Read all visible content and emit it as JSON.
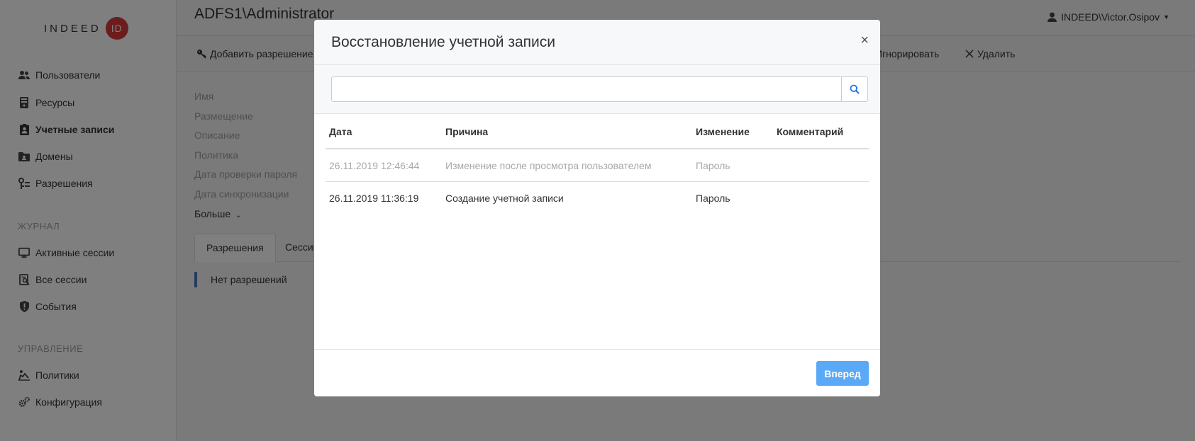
{
  "logo": {
    "text": "INDEED",
    "badge": "ID",
    "badge_color": "#d63b3b"
  },
  "sidebar": {
    "items": [
      {
        "label": "Пользователи",
        "icon": "users-icon"
      },
      {
        "label": "Ресурсы",
        "icon": "server-icon"
      },
      {
        "label": "Учетные записи",
        "icon": "id-badge-icon",
        "active": true
      },
      {
        "label": "Домены",
        "icon": "folder-icon"
      },
      {
        "label": "Разрешения",
        "icon": "key-icon"
      }
    ],
    "journal_title": "ЖУРНАЛ",
    "journal_items": [
      {
        "label": "Активные сессии",
        "icon": "monitor-icon"
      },
      {
        "label": "Все сессии",
        "icon": "session-search-icon"
      },
      {
        "label": "События",
        "icon": "shield-alert-icon"
      }
    ],
    "management_title": "УПРАВЛЕНИЕ",
    "management_items": [
      {
        "label": "Политики",
        "icon": "policy-icon"
      },
      {
        "label": "Конфигурация",
        "icon": "gears-icon"
      }
    ]
  },
  "header": {
    "title": "ADFS1\\Administrator",
    "user": "INDEED\\Victor.Osipov"
  },
  "toolbar": {
    "add_permission": "Добавить разрешение",
    "ignore": "Игнорировать",
    "delete": "Удалить"
  },
  "properties": [
    "Имя",
    "Размещение",
    "Описание",
    "Политика",
    "Дата проверки пароля",
    "Дата синхронизации"
  ],
  "more_label": "Больше",
  "tabs": [
    "Разрешения",
    "Сессии"
  ],
  "empty_permissions": "Нет разрешений",
  "modal": {
    "title": "Восстановление учетной записи",
    "close": "×",
    "search": {
      "value": "",
      "placeholder": ""
    },
    "columns": [
      "Дата",
      "Причина",
      "Изменение",
      "Комментарий"
    ],
    "rows": [
      {
        "date": "26.11.2019 12:46:44",
        "reason": "Изменение после просмотра пользователем",
        "change": "Пароль",
        "comment": "",
        "muted": true
      },
      {
        "date": "26.11.2019 11:36:19",
        "reason": "Создание учетной записи",
        "change": "Пароль",
        "comment": "",
        "muted": false
      }
    ],
    "next_button": "Вперед",
    "accent_color": "#5aa9f6"
  }
}
